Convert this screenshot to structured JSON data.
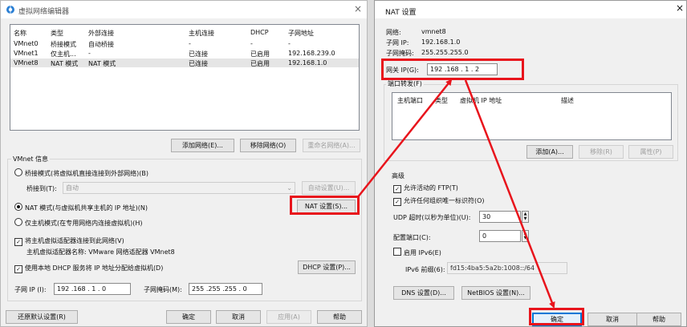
{
  "left": {
    "title": "虚拟网络编辑器",
    "close": "×",
    "headers": [
      "名称",
      "类型",
      "外部连接",
      "主机连接",
      "DHCP",
      "子网地址"
    ],
    "rows": [
      [
        "VMnet0",
        "桥接模式",
        "自动桥接",
        "-",
        "-",
        "-"
      ],
      [
        "VMnet1",
        "仅主机...",
        "-",
        "已连接",
        "已启用",
        "192.168.239.0"
      ],
      [
        "VMnet8",
        "NAT 模式",
        "NAT 模式",
        "已连接",
        "已启用",
        "192.168.1.0"
      ]
    ],
    "add_network": "添加网络(E)...",
    "remove_network": "移除网络(O)",
    "rename_network": "重命名网络(A)...",
    "vmnet_info": "VMnet 信息",
    "bridge_mode": "桥接模式(将虚拟机直接连接到外部网络)(B)",
    "bridge_to_label": "桥接到(T):",
    "bridge_to_value": "自动",
    "auto_settings": "自动设置(U)...",
    "nat_mode": "NAT 模式(与虚拟机共享主机的 IP 地址)(N)",
    "nat_settings": "NAT 设置(S)...",
    "host_only": "仅主机模式(在专用网络内连接虚拟机)(H)",
    "connect_adapter": "将主机虚拟适配器连接到此网络(V)",
    "adapter_name": "主机虚拟适配器名称: VMware 网络适配器 VMnet8",
    "use_dhcp": "使用本地 DHCP 服务将 IP 地址分配给虚拟机(D)",
    "dhcp_settings": "DHCP 设置(P)...",
    "subnet_ip_label": "子网 IP (I):",
    "subnet_ip_value": "192 .168 . 1 . 0",
    "subnet_mask_label": "子网掩码(M):",
    "subnet_mask_value": "255 .255 .255 . 0",
    "restore_defaults": "还原默认设置(R)",
    "ok": "确定",
    "cancel": "取消",
    "apply": "应用(A)",
    "help": "帮助"
  },
  "right": {
    "title": "NAT 设置",
    "close": "×",
    "network_label": "网络:",
    "network_value": "vmnet8",
    "subnet_ip_label": "子网 IP:",
    "subnet_ip_value": "192.168.1.0",
    "subnet_mask_label": "子网掩码:",
    "subnet_mask_value": "255.255.255.0",
    "gateway_label": "网关 IP(G):",
    "gateway_value": "192 .168 . 1 . 2",
    "port_forwarding": "端口转发(F)",
    "pf_headers": [
      "主机端口",
      "类型",
      "虚拟机 IP 地址",
      "描述"
    ],
    "add": "添加(A)...",
    "remove": "移除(R)",
    "properties": "属性(P)",
    "advanced": "高级",
    "allow_ftp": "允许活动的 FTP(T)",
    "allow_oui": "允许任何组织唯一标识符(O)",
    "udp_timeout_label": "UDP 超时(以秒为单位)(U):",
    "udp_timeout_value": "30",
    "config_port_label": "配置端口(C):",
    "config_port_value": "0",
    "enable_ipv6": "启用 IPv6(E)",
    "ipv6_prefix_label": "IPv6 前缀(6):",
    "ipv6_prefix_value": "fd15:4ba5:5a2b:1008::/64",
    "dns_settings": "DNS 设置(D)...",
    "netbios_settings": "NetBIOS 设置(N)...",
    "ok": "确定",
    "cancel": "取消",
    "help": "帮助"
  },
  "colors": {
    "annotation": "#e8141c",
    "accent": "#0078d7"
  }
}
